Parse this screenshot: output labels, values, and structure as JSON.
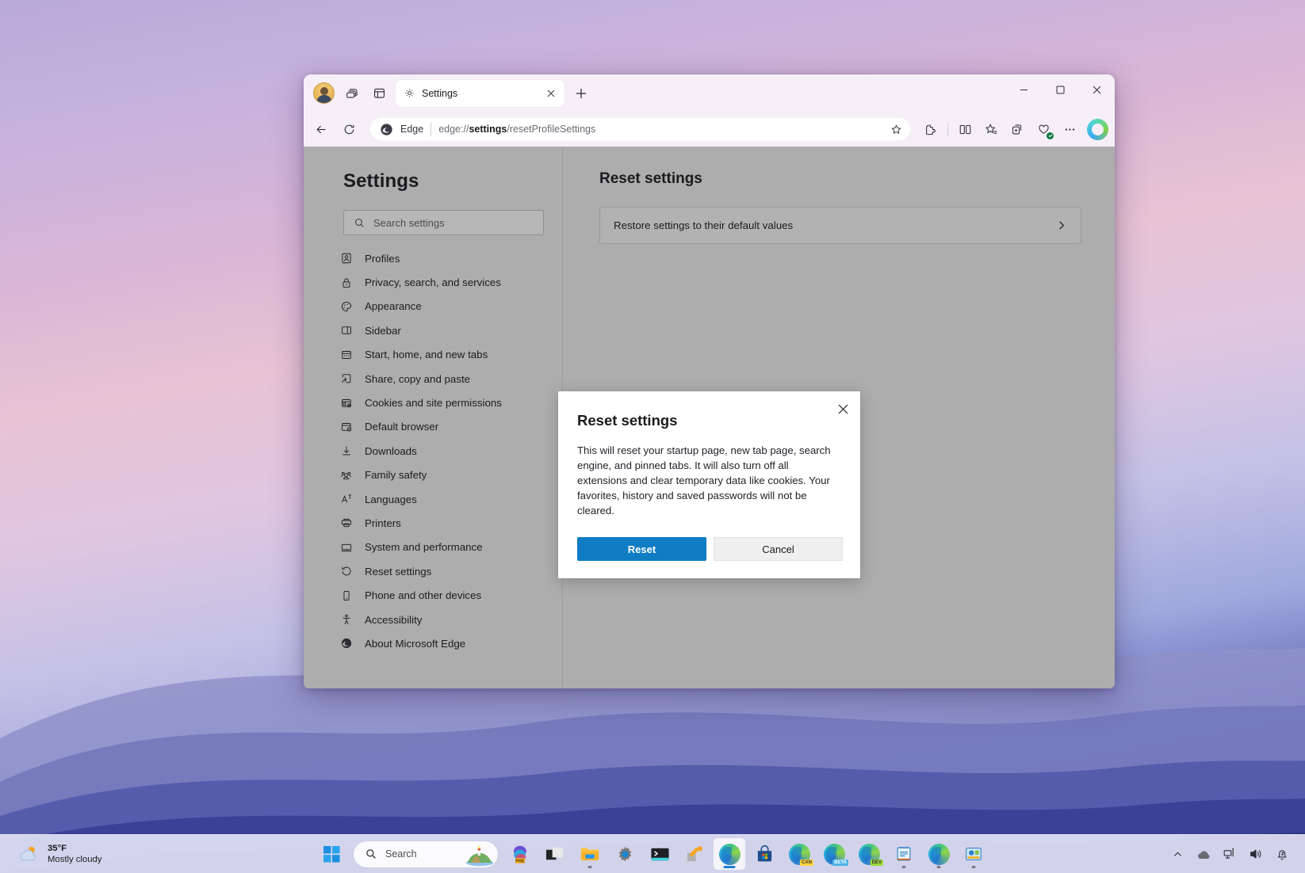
{
  "browser": {
    "tab": {
      "title": "Settings",
      "favicon": "gear-icon"
    },
    "omnibox": {
      "brand": "Edge",
      "url_prefix": "edge://",
      "url_bold": "settings",
      "url_suffix": "/resetProfileSettings",
      "url_full": "edge://settings/resetProfileSettings"
    },
    "toolbar_icons": [
      "copilot-avatar-icon",
      "workspaces-icon",
      "tab-actions-icon",
      "browser-essentials-icon",
      "split-screen-icon",
      "favorites-icon",
      "collections-icon",
      "browser-essentials-health-icon",
      "settings-more-icon"
    ],
    "window_controls": {
      "minimize": "–",
      "maximize": "☐",
      "close": "✕"
    }
  },
  "settings": {
    "title": "Settings",
    "search": {
      "placeholder": "Search settings",
      "value": ""
    },
    "nav_items": [
      {
        "label": "Profiles",
        "icon": "profiles-icon"
      },
      {
        "label": "Privacy, search, and services",
        "icon": "lock-icon"
      },
      {
        "label": "Appearance",
        "icon": "palette-icon"
      },
      {
        "label": "Sidebar",
        "icon": "sidebar-icon"
      },
      {
        "label": "Start, home, and new tabs",
        "icon": "home-icon"
      },
      {
        "label": "Share, copy and paste",
        "icon": "share-icon"
      },
      {
        "label": "Cookies and site permissions",
        "icon": "cookies-icon"
      },
      {
        "label": "Default browser",
        "icon": "default-browser-icon"
      },
      {
        "label": "Downloads",
        "icon": "download-icon"
      },
      {
        "label": "Family safety",
        "icon": "family-icon"
      },
      {
        "label": "Languages",
        "icon": "languages-icon"
      },
      {
        "label": "Printers",
        "icon": "printer-icon"
      },
      {
        "label": "System and performance",
        "icon": "system-icon"
      },
      {
        "label": "Reset settings",
        "icon": "reset-icon"
      },
      {
        "label": "Phone and other devices",
        "icon": "phone-icon"
      },
      {
        "label": "Accessibility",
        "icon": "accessibility-icon"
      },
      {
        "label": "About Microsoft Edge",
        "icon": "edge-logo-icon"
      }
    ],
    "main": {
      "heading": "Reset settings",
      "card_label": "Restore settings to their default values",
      "card_chevron": "chevron-right-icon"
    }
  },
  "dialog": {
    "title": "Reset settings",
    "body": "This will reset your startup page, new tab page, search engine, and pinned tabs. It will also turn off all extensions and clear temporary data like cookies. Your favorites, history and saved passwords will not be cleared.",
    "primary_label": "Reset",
    "secondary_label": "Cancel",
    "close_icon": "close-icon",
    "primary_color": "#0f7cc4"
  },
  "taskbar": {
    "weather": {
      "temperature": "35°F",
      "condition": "Mostly cloudy",
      "icon": "partly-cloudy-icon"
    },
    "start_label": "start-button",
    "search": {
      "placeholder": "Search",
      "icon": "search-icon"
    },
    "apps": [
      {
        "name": "copilot-taskbar-icon",
        "badge": "PRE"
      },
      {
        "name": "file-explorer-dark-icon",
        "badge": ""
      },
      {
        "name": "file-explorer-icon",
        "badge": ""
      },
      {
        "name": "settings-app-icon",
        "badge": ""
      },
      {
        "name": "terminal-icon",
        "badge": ""
      },
      {
        "name": "tools-icon",
        "badge": ""
      },
      {
        "name": "microsoft-edge-icon",
        "badge": ""
      },
      {
        "name": "microsoft-store-icon",
        "badge": ""
      },
      {
        "name": "edge-canary-icon",
        "badge": "CAN"
      },
      {
        "name": "edge-beta-icon",
        "badge": "BETA"
      },
      {
        "name": "edge-dev-icon",
        "badge": "DEV"
      },
      {
        "name": "notepad-icon",
        "badge": ""
      },
      {
        "name": "edge-profile-icon",
        "badge": ""
      },
      {
        "name": "media-app-icon",
        "badge": ""
      }
    ],
    "tray": [
      "show-hidden-icons-chevron",
      "onedrive-icon",
      "network-icon",
      "volume-icon",
      "notifications-dnd-icon"
    ]
  }
}
